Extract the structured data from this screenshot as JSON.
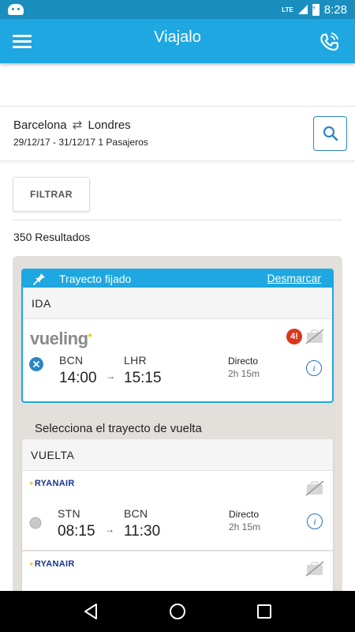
{
  "status_bar": {
    "network": "LTE",
    "time": "8:28"
  },
  "app_bar": {
    "title": "Viajalo"
  },
  "search": {
    "origin": "Barcelona",
    "destination": "Londres",
    "details": "29/12/17 - 31/12/17 1 Pasajeros"
  },
  "filter_label": "FILTRAR",
  "results_count": "350 Resultados",
  "fixed_trip": {
    "header": "Trayecto fijado",
    "unmark_label": "Desmarcar",
    "leg_label": "IDA",
    "flight": {
      "airline": "vueling",
      "seats_badge": "4!",
      "from_code": "BCN",
      "to_code": "LHR",
      "depart": "14:00",
      "arrive": "15:15",
      "stops": "Directo",
      "duration": "2h 15m"
    }
  },
  "return_section": {
    "title": "Selecciona el trayecto de vuelta",
    "leg_label": "VUELTA",
    "flights": [
      {
        "airline": "RYANAIR",
        "from_code": "STN",
        "to_code": "BCN",
        "depart": "08:15",
        "arrive": "11:30",
        "stops": "Directo",
        "duration": "2h 15m"
      },
      {
        "airline": "RYANAIR"
      }
    ]
  },
  "colors": {
    "primary": "#1ea7e0",
    "status_bar": "#1a8fbf",
    "accent_blue": "#2a86c5",
    "badge_red": "#d9381e",
    "panel_bg": "#e3e0dc"
  }
}
